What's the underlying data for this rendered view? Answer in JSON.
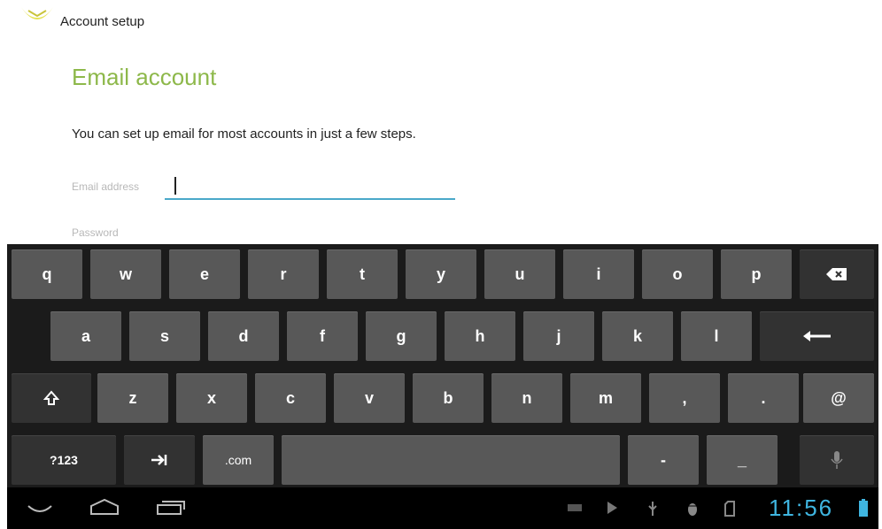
{
  "action_bar": {
    "title": "Account setup",
    "icon": "email-app-icon"
  },
  "main": {
    "heading": "Email account",
    "description": "You can set up email for most accounts in just a few steps.",
    "email_field": {
      "label": "Email address",
      "value": ""
    },
    "password_field": {
      "label": "Password"
    }
  },
  "keyboard": {
    "row1": [
      "q",
      "w",
      "e",
      "r",
      "t",
      "y",
      "u",
      "i",
      "o",
      "p"
    ],
    "row2": [
      "a",
      "s",
      "d",
      "f",
      "g",
      "h",
      "j",
      "k",
      "l"
    ],
    "row3": [
      "z",
      "x",
      "c",
      "v",
      "b",
      "n",
      "m",
      ",",
      ".",
      "@"
    ],
    "row4": {
      "symbols": "?123",
      "dotcom": ".com",
      "dash": "-",
      "underscore": "_"
    },
    "icons": {
      "backspace": "backspace-icon",
      "enter": "enter-icon",
      "shift": "shift-icon",
      "tab": "tab-icon",
      "mic": "microphone-icon"
    }
  },
  "system_bar": {
    "clock": "11:56",
    "nav": [
      "back-icon",
      "home-icon",
      "recent-apps-icon"
    ],
    "status_icons": [
      "keyboard-icon",
      "play-store-icon",
      "usb-icon",
      "debug-icon",
      "sdcard-icon",
      "battery-icon"
    ],
    "accent_color": "#3fb5e0"
  },
  "colors": {
    "heading": "#8db84a",
    "input_underline": "#4aa9c9",
    "key": "#585858",
    "key_dark": "#323232",
    "keyboard_bg": "#1b1b1b"
  }
}
